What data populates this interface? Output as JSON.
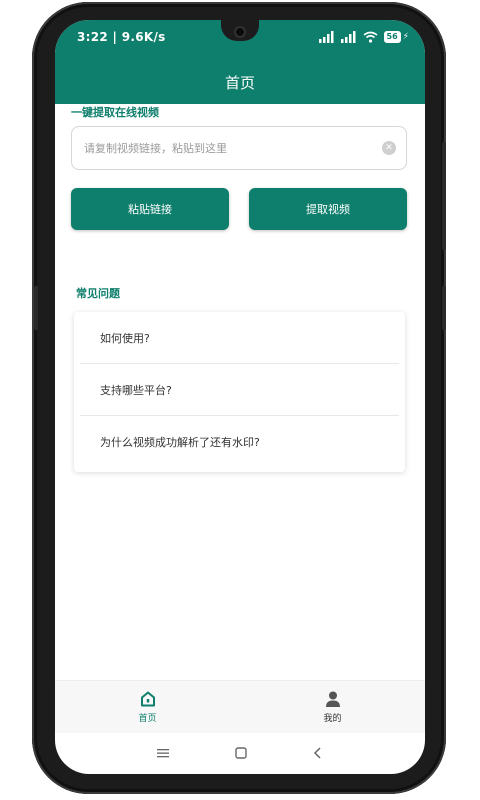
{
  "status": {
    "time": "3:22",
    "speed": "9.6K/s",
    "battery": "56"
  },
  "app": {
    "title": "首页"
  },
  "extract": {
    "section_label": "一键提取在线视频",
    "input_placeholder": "请复制视频链接，粘贴到这里",
    "paste_button": "粘贴链接",
    "extract_button": "提取视频"
  },
  "faq": {
    "section_label": "常见问题",
    "items": [
      "如何使用?",
      "支持哪些平台?",
      "为什么视频成功解析了还有水印?"
    ]
  },
  "tabs": [
    {
      "label": "首页",
      "icon": "home-icon",
      "active": true
    },
    {
      "label": "我的",
      "icon": "user-icon",
      "active": false
    }
  ],
  "colors": {
    "primary": "#0f7f6d",
    "background": "#ffffff"
  }
}
